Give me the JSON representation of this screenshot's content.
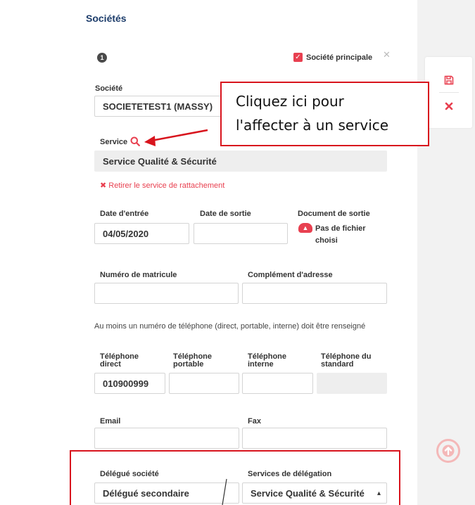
{
  "section": {
    "title": "Sociétés",
    "number": "1"
  },
  "principal": {
    "label": "Société principale",
    "checked": true
  },
  "societe": {
    "label": "Société",
    "value": "SOCIETETEST1 (MASSY)"
  },
  "callout": {
    "line1": "Cliquez ici pour",
    "line2": "l'affecter à un service"
  },
  "service": {
    "label": "Service",
    "value": "Service Qualité & Sécurité",
    "remove_link": "✖ Retirer le service de rattachement"
  },
  "dates": {
    "entree_label": "Date d'entrée",
    "entree_value": "04/05/2020",
    "sortie_label": "Date de sortie",
    "sortie_value": ""
  },
  "document": {
    "label": "Document de sortie",
    "line1": "Pas de fichier",
    "line2": "choisi"
  },
  "matricule": {
    "label": "Numéro de matricule",
    "value": ""
  },
  "adresse": {
    "label": "Complément d'adresse",
    "value": ""
  },
  "phone_help": "Au moins un numéro de téléphone (direct, portable, interne) doit être renseigné",
  "phones": {
    "direct_label_1": "Téléphone",
    "direct_label_2": "direct",
    "direct_value": "010900999",
    "portable_label_1": "Téléphone",
    "portable_label_2": "portable",
    "portable_value": "",
    "interne_label_1": "Téléphone",
    "interne_label_2": "interne",
    "interne_value": "",
    "standard_label_1": "Téléphone du",
    "standard_label_2": "standard",
    "standard_value": ""
  },
  "email": {
    "label": "Email",
    "value": ""
  },
  "fax": {
    "label": "Fax",
    "value": ""
  },
  "delegue": {
    "label": "Délégué société",
    "value": "Délégué secondaire"
  },
  "delegation": {
    "label": "Services de délégation",
    "value": "Service Qualité & Sécurité",
    "caret": "▴"
  },
  "icons": {
    "save": "save-icon",
    "close": "close-icon",
    "scroll_top": "arrow-up-circle-icon",
    "search": "search-icon",
    "upload": "cloud-upload-icon"
  },
  "colors": {
    "accent": "#e84050",
    "title": "#1d3d6b",
    "annotation": "#d8141d"
  }
}
